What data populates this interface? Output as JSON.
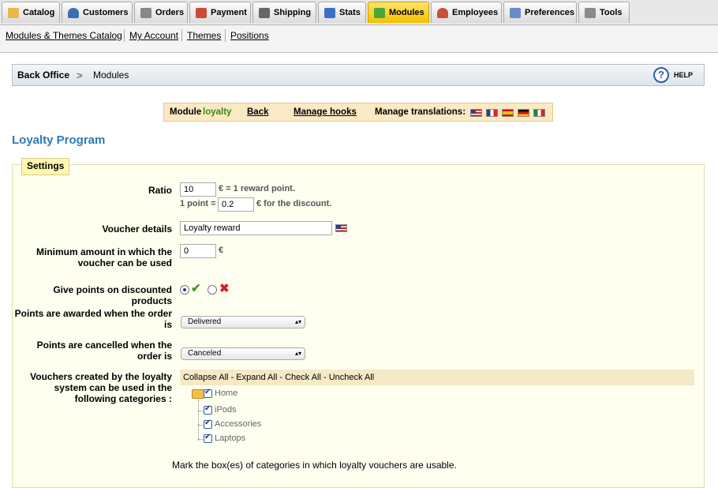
{
  "tabs": [
    {
      "label": "Catalog",
      "icon": "folder-icon",
      "color": "#e8b84a"
    },
    {
      "label": "Customers",
      "icon": "customer-icon",
      "color": "#3b6fb0"
    },
    {
      "label": "Orders",
      "icon": "cart-icon",
      "color": "#888888"
    },
    {
      "label": "Payment",
      "icon": "payment-icon",
      "color": "#d04a3a"
    },
    {
      "label": "Shipping",
      "icon": "truck-icon",
      "color": "#666666"
    },
    {
      "label": "Stats",
      "icon": "stats-icon",
      "color": "#3a6ec8"
    },
    {
      "label": "Modules",
      "icon": "puzzle-icon",
      "color": "#4aa83a",
      "active": true
    },
    {
      "label": "Employees",
      "icon": "employee-icon",
      "color": "#c8503a"
    },
    {
      "label": "Preferences",
      "icon": "preferences-icon",
      "color": "#6a8ac8"
    },
    {
      "label": "Tools",
      "icon": "wrench-icon",
      "color": "#8a8a8a"
    }
  ],
  "subnav": [
    "Modules & Themes Catalog",
    "My Account",
    "Themes",
    "Positions"
  ],
  "breadcrumb": {
    "root": "Back Office",
    "current": "Modules"
  },
  "help_label": "HELP",
  "module_bar": {
    "module_prefix": "Module",
    "module_name": "loyalty",
    "back": "Back",
    "manage_hooks": "Manage hooks",
    "manage_translations": "Manage translations:",
    "flags": [
      "en",
      "fr",
      "es",
      "de",
      "it"
    ]
  },
  "heading": "Loyalty Program",
  "settings": {
    "legend": "Settings",
    "ratio_label": "Ratio",
    "ratio_value": "10",
    "ratio_suffix": "€ = 1 reward point.",
    "point_prefix": "1 point =",
    "point_value": "0.2",
    "point_suffix": "€ for the discount.",
    "voucher_label": "Voucher details",
    "voucher_value": "Loyalty reward",
    "min_label": "Minimum amount in which the voucher can be used",
    "min_value": "0",
    "min_suffix": "€",
    "discounted_label": "Give points on discounted products",
    "discounted_value": "yes",
    "awarded_label": "Points are awarded when the order is",
    "awarded_value": "Delivered",
    "cancelled_label": "Points are cancelled when the order is",
    "cancelled_value": "Canceled",
    "categories_label": "Vouchers created by the loyalty system can be used in the following categories :",
    "tree_actions": [
      "Collapse All",
      "Expand All",
      "Check All",
      "Uncheck All"
    ],
    "tree_sep": "-",
    "categories": [
      {
        "label": "Home",
        "checked": true
      },
      {
        "label": "iPods",
        "checked": true
      },
      {
        "label": "Accessories",
        "checked": true
      },
      {
        "label": "Laptops",
        "checked": true
      }
    ],
    "footer_note": "Mark the box(es) of categories in which loyalty vouchers are usable."
  }
}
